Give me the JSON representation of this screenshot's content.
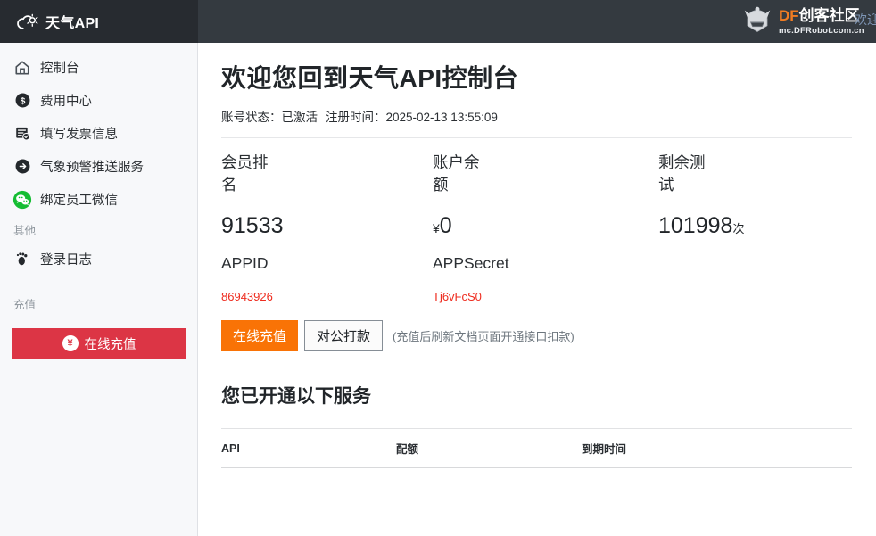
{
  "header": {
    "brand_text": "天气API",
    "brand_icon": "cloud-sun-icon",
    "partner_logo_icon": "dfrobot-head-icon",
    "partner_name_prefix": "DF",
    "partner_name_suffix": "创客社区",
    "partner_url": "mc.DFRobot.com.cn",
    "welcome_fragment": "欢迎",
    "bg_color": "#343a40",
    "brand_bg_color": "#272b30",
    "accent_orange": "#f07c22"
  },
  "sidebar": {
    "bg_color": "#f7f8fa",
    "items": [
      {
        "label": "控制台",
        "icon": "home-icon"
      },
      {
        "label": "费用中心",
        "icon": "dollar-circle-icon"
      },
      {
        "label": "填写发票信息",
        "icon": "invoice-check-icon"
      },
      {
        "label": "气象预警推送服务",
        "icon": "arrow-right-circle-icon"
      },
      {
        "label": "绑定员工微信",
        "icon": "wechat-icon"
      }
    ],
    "group_other_label": "其他",
    "other_items": [
      {
        "label": "登录日志",
        "icon": "footprint-icon"
      }
    ],
    "group_recharge_label": "充值",
    "recharge_button": {
      "label": "在线充值",
      "icon": "yen-circle-icon",
      "color": "#dc3545"
    }
  },
  "main": {
    "page_title": "欢迎您回到天气API控制台",
    "status": {
      "account_status_label": "账号状态：",
      "account_status_value": "已激活",
      "register_time_label": "注册时间：",
      "register_time_value": "2025-02-13 13:55:09"
    },
    "stats": [
      {
        "label": "会员排名",
        "value": "91533",
        "unit_prefix": "",
        "unit_suffix": ""
      },
      {
        "label": "账户余额",
        "value": "0",
        "unit_prefix": "¥",
        "unit_suffix": ""
      },
      {
        "label": "剩余测试",
        "value": "101998",
        "unit_prefix": "",
        "unit_suffix": "次"
      }
    ],
    "credentials": [
      {
        "label": "APPID",
        "value": "86943926"
      },
      {
        "label": "APPSecret",
        "value": "Tj6vFcS0"
      }
    ],
    "credential_color": "#ee2d20",
    "actions": {
      "online_pay_label": "在线充值",
      "online_pay_color": "#f97306",
      "corp_pay_label": "对公打款",
      "note": "(充值后刷新文档页面开通接口扣款)"
    },
    "services": {
      "title": "您已开通以下服务",
      "columns": [
        "API",
        "配额",
        "到期时间"
      ],
      "rows": []
    }
  }
}
